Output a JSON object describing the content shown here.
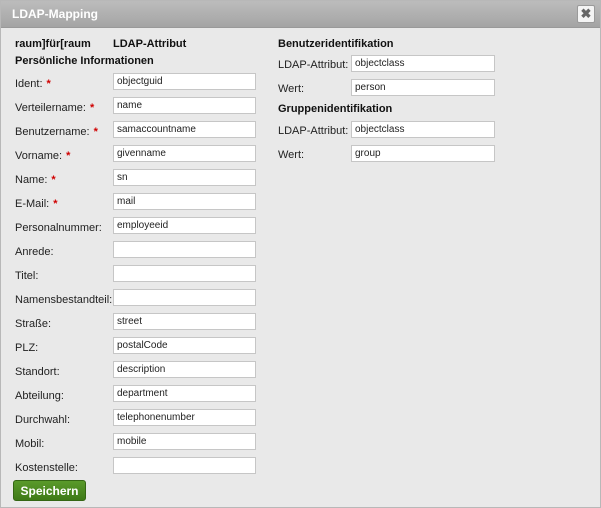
{
  "dialog": {
    "title": "LDAP-Mapping",
    "close_glyph": "✖",
    "col_header_left": "raum]für[raum",
    "col_header_right": "LDAP-Attribut",
    "section_personal": "Persönliche Informationen",
    "save_label": "Speichern"
  },
  "fields": [
    {
      "label": "Ident:",
      "required": true,
      "value": "objectguid"
    },
    {
      "label": "Verteilername:",
      "required": true,
      "value": "name"
    },
    {
      "label": "Benutzername:",
      "required": true,
      "value": "samaccountname"
    },
    {
      "label": "Vorname:",
      "required": true,
      "value": "givenname"
    },
    {
      "label": "Name:",
      "required": true,
      "value": "sn"
    },
    {
      "label": "E-Mail:",
      "required": true,
      "value": "mail"
    },
    {
      "label": "Personalnummer:",
      "required": false,
      "value": "employeeid"
    },
    {
      "label": "Anrede:",
      "required": false,
      "value": ""
    },
    {
      "label": "Titel:",
      "required": false,
      "value": ""
    },
    {
      "label": "Namensbestandteil:",
      "required": false,
      "value": ""
    },
    {
      "label": "Straße:",
      "required": false,
      "value": "street"
    },
    {
      "label": "PLZ:",
      "required": false,
      "value": "postalCode"
    },
    {
      "label": "Standort:",
      "required": false,
      "value": "description"
    },
    {
      "label": "Abteilung:",
      "required": false,
      "value": "department"
    },
    {
      "label": "Durchwahl:",
      "required": false,
      "value": "telephonenumber"
    },
    {
      "label": "Mobil:",
      "required": false,
      "value": "mobile"
    },
    {
      "label": "Kostenstelle:",
      "required": false,
      "value": ""
    }
  ],
  "required_marker": "*",
  "user_id": {
    "header": "Benutzeridentifikation",
    "attr_label": "LDAP-Attribut:",
    "attr_value": "objectclass",
    "value_label": "Wert:",
    "value_value": "person"
  },
  "group_id": {
    "header": "Gruppenidentifikation",
    "attr_label": "LDAP-Attribut:",
    "attr_value": "objectclass",
    "value_label": "Wert:",
    "value_value": "group"
  },
  "colors": {
    "titlebar": "#a9a9a9",
    "background": "#e9e9e9",
    "required": "#d00000",
    "save_button": "#4a8a22"
  }
}
